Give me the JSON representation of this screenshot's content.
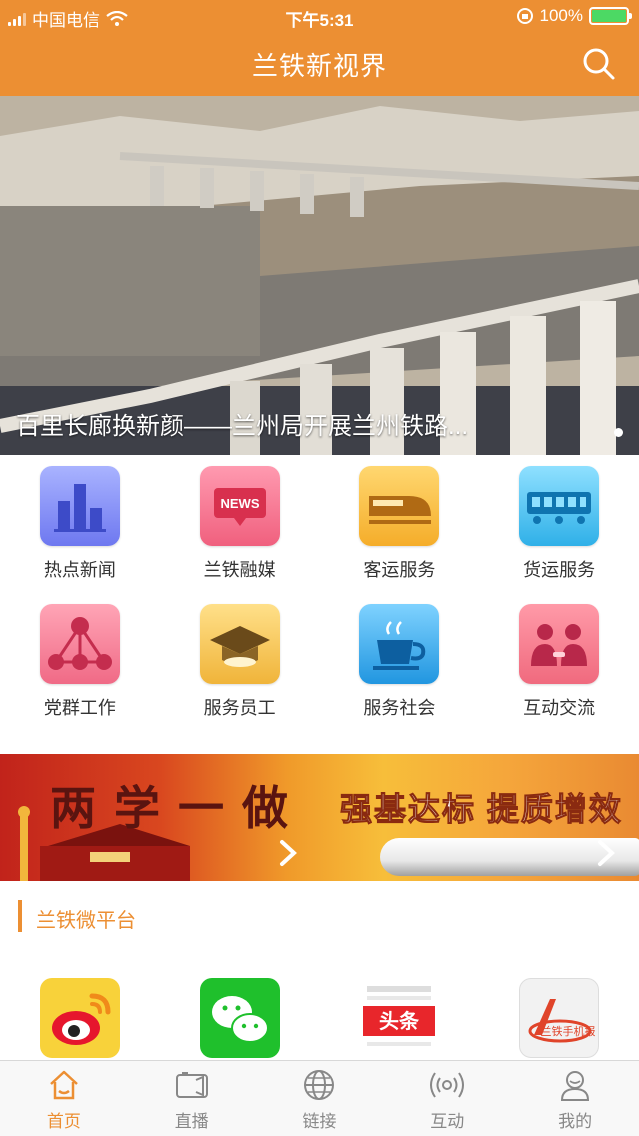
{
  "status_bar": {
    "carrier": "中国电信",
    "time": "下午5:31",
    "battery": "100%"
  },
  "nav": {
    "title": "兰铁新视界",
    "search_icon": "search-icon"
  },
  "hero": {
    "caption": "百里长廊换新颜——兰州局开展兰州铁路..."
  },
  "grid": [
    {
      "label": "热点新闻",
      "icon": "bar-chart-icon"
    },
    {
      "label": "兰铁融媒",
      "icon": "news-icon"
    },
    {
      "label": "客运服务",
      "icon": "bullet-train-icon"
    },
    {
      "label": "货运服务",
      "icon": "freight-train-icon"
    },
    {
      "label": "党群工作",
      "icon": "network-icon"
    },
    {
      "label": "服务员工",
      "icon": "graduation-cap-icon"
    },
    {
      "label": "服务社会",
      "icon": "coffee-cup-icon"
    },
    {
      "label": "互动交流",
      "icon": "people-icon"
    }
  ],
  "banner": {
    "left_text": "两学一做",
    "right_text": "强基达标 提质增效"
  },
  "section": {
    "title": "兰铁微平台"
  },
  "platforms": [
    {
      "icon": "weibo-icon"
    },
    {
      "icon": "wechat-icon"
    },
    {
      "icon": "toutiao-icon",
      "text": "头条"
    },
    {
      "icon": "lantie-mobile-news-icon",
      "text": "兰铁手机报"
    }
  ],
  "tabs": [
    {
      "label": "首页",
      "icon": "home-icon",
      "active": true
    },
    {
      "label": "直播",
      "icon": "video-camera-icon",
      "active": false
    },
    {
      "label": "链接",
      "icon": "globe-icon",
      "active": false
    },
    {
      "label": "互动",
      "icon": "broadcast-icon",
      "active": false
    },
    {
      "label": "我的",
      "icon": "user-icon",
      "active": false
    }
  ],
  "colors": {
    "accent": "#ec8f33",
    "tab_inactive": "#888888"
  }
}
